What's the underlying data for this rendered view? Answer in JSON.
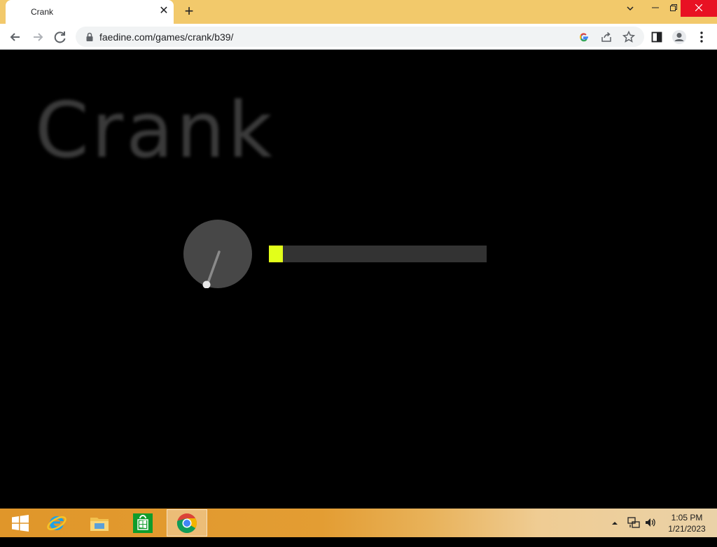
{
  "browser": {
    "tab_title": "Crank",
    "tab_close_symbol": "✕",
    "new_tab_symbol": "+",
    "url": "faedine.com/games/crank/b39/",
    "window_controls": {
      "dropdown": "⌄",
      "minimize": "—",
      "restore": "❐",
      "close": "✕"
    }
  },
  "game": {
    "title": "Crank",
    "progress_fraction": 0.065,
    "accent_color": "#e2ff1a"
  },
  "taskbar": {
    "items": [
      "start-icon",
      "internet-explorer-icon",
      "file-explorer-icon",
      "store-icon",
      "chrome-icon"
    ],
    "clock_time": "1:05 PM",
    "clock_date": "1/21/2023"
  }
}
